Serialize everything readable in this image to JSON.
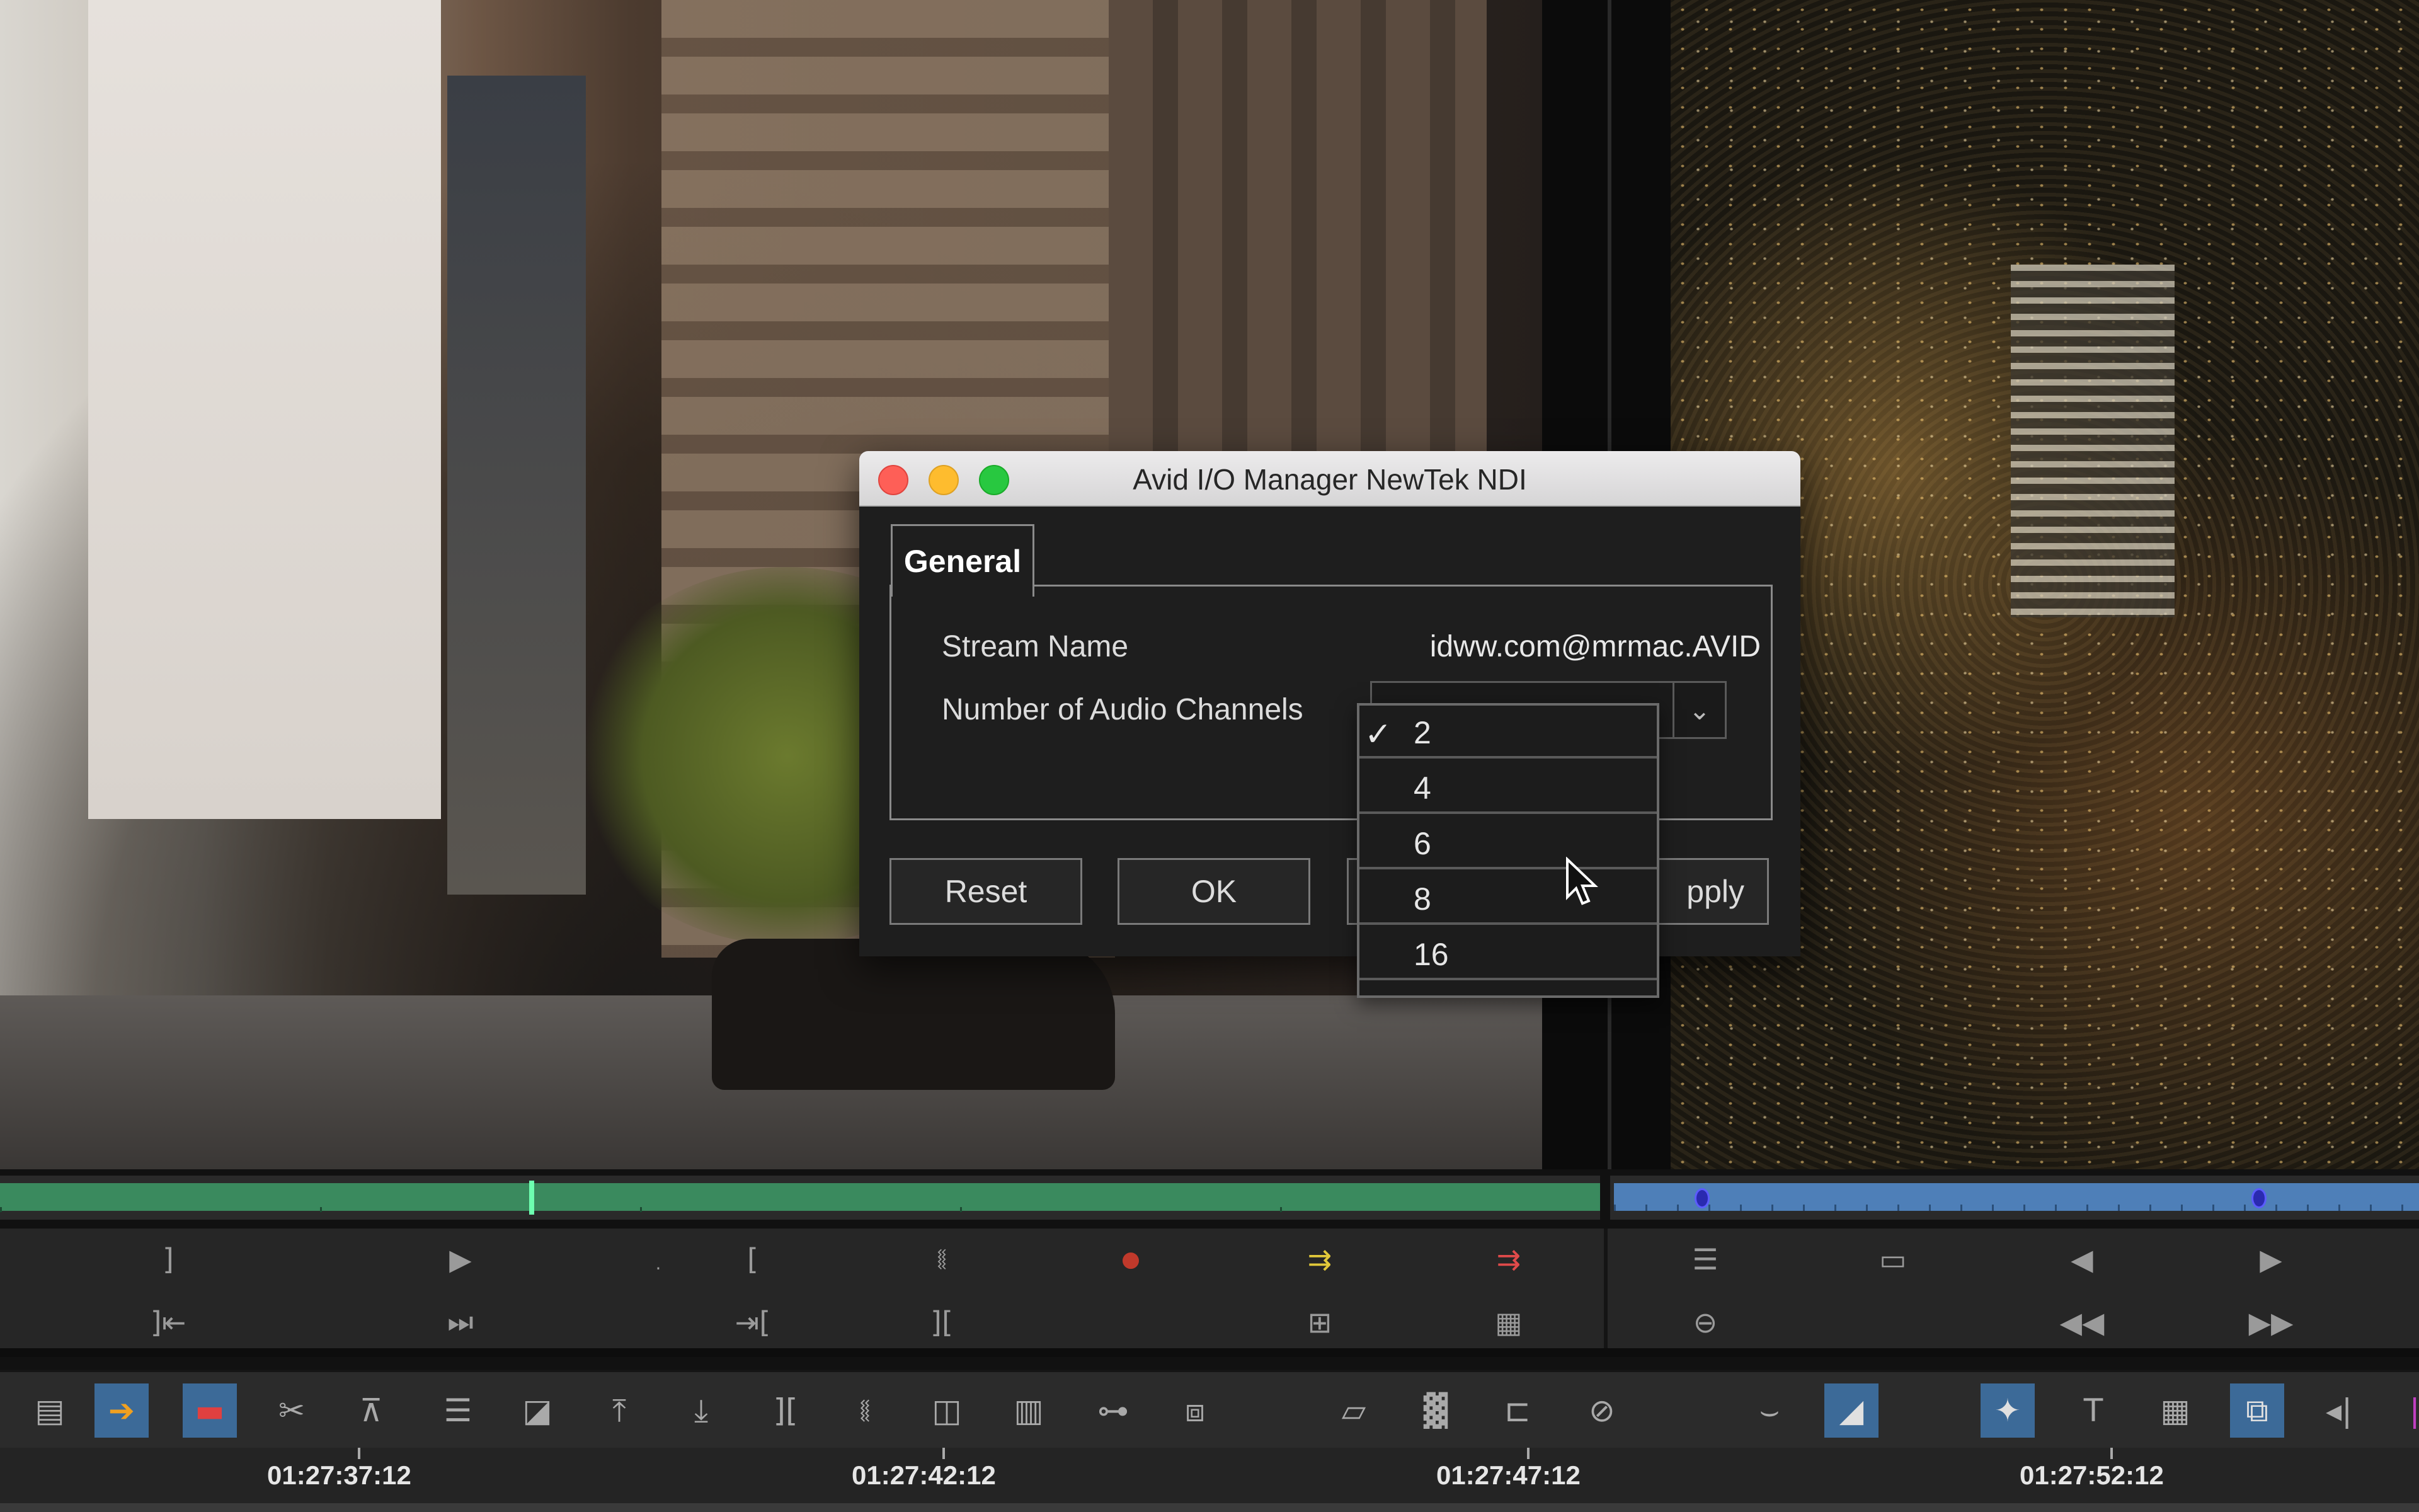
{
  "dialog": {
    "title": "Avid I/O Manager NewTek NDI",
    "tab_general": "General",
    "stream_name_label": "Stream Name",
    "stream_name_value": "idww.com@mrmac.AVID",
    "audio_channels_label": "Number of Audio Channels",
    "buttons": {
      "reset": "Reset",
      "ok": "OK",
      "apply": "pply"
    }
  },
  "audio_dropdown": {
    "selected": "2",
    "options": [
      "2",
      "4",
      "6",
      "8",
      "16"
    ]
  },
  "timeline": {
    "timecodes": [
      "01:27:37:12",
      "01:27:42:12",
      "01:27:47:12",
      "01:27:52:12"
    ]
  },
  "colors": {
    "position_bar_left": "#3a8a5e",
    "position_bar_right": "#4e7fb8",
    "active_tool": "#3c6a98",
    "close": "#fe5f57",
    "minimize": "#febc2e",
    "zoom": "#28c840"
  }
}
